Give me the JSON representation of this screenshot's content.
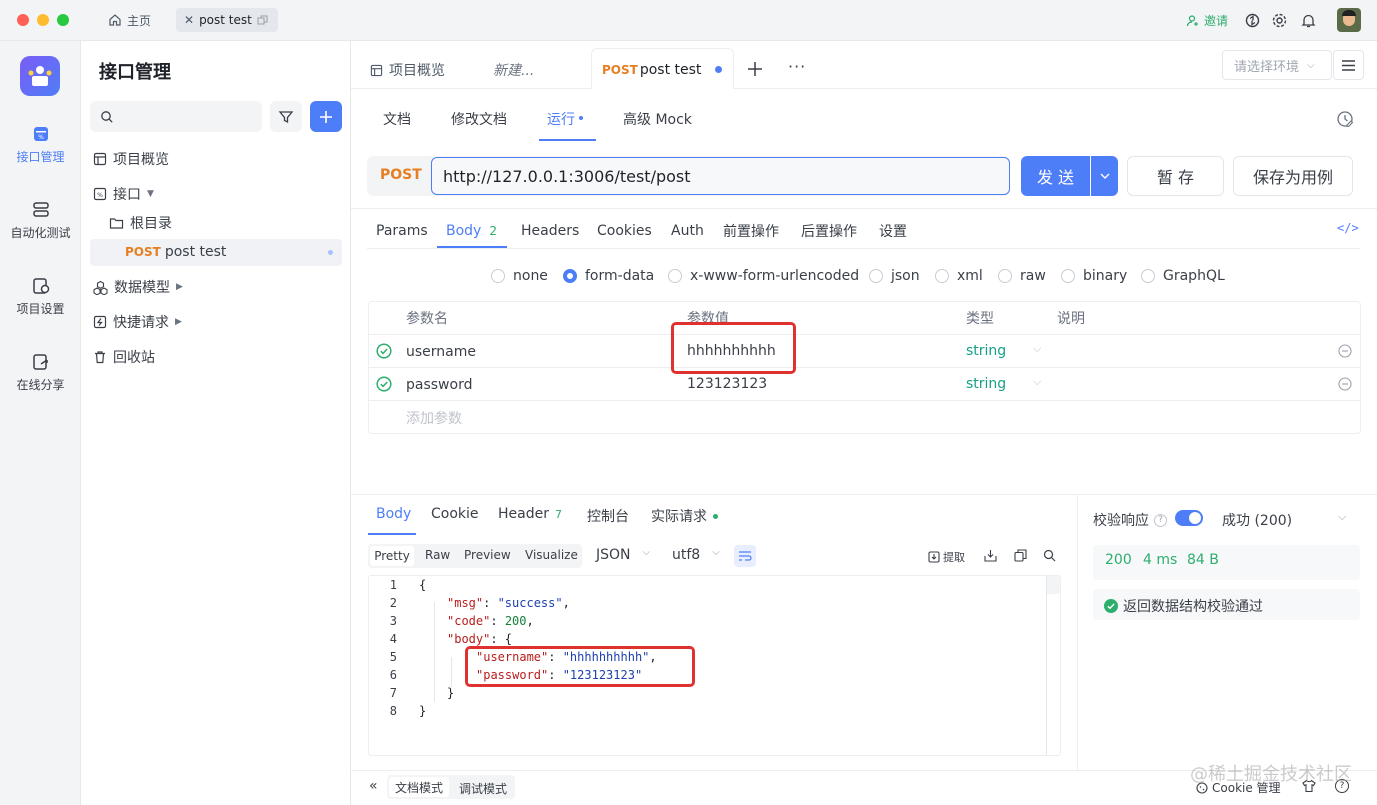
{
  "titlebar": {
    "home_tab": "主页",
    "active_tab": "post test",
    "invite": "邀请"
  },
  "rail": {
    "items": [
      {
        "label": "接口管理",
        "icon": "api-icon"
      },
      {
        "label": "自动化测试",
        "icon": "automation-icon"
      },
      {
        "label": "项目设置",
        "icon": "project-settings-icon"
      },
      {
        "label": "在线分享",
        "icon": "share-icon"
      }
    ]
  },
  "sidebar": {
    "title": "接口管理",
    "search_placeholder": "",
    "tree": {
      "overview": "项目概览",
      "api": "接口",
      "root": "根目录",
      "item_method": "POST",
      "item_name": "post test",
      "models": "数据模型",
      "quick": "快捷请求",
      "trash": "回收站"
    }
  },
  "main": {
    "tabs": {
      "overview": "项目概览",
      "new": "新建...",
      "active_method": "POST",
      "active_name": "post test"
    },
    "env_placeholder": "请选择环境",
    "subtabs": [
      "文档",
      "修改文档",
      "运行",
      "高级 Mock"
    ],
    "request": {
      "method": "POST",
      "url": "http://127.0.0.1:3006/test/post",
      "send": "发 送",
      "save": "暂 存",
      "save_case": "保存为用例"
    },
    "param_tabs": {
      "params": "Params",
      "body": "Body",
      "body_count": "2",
      "headers": "Headers",
      "cookies": "Cookies",
      "auth": "Auth",
      "pre": "前置操作",
      "post": "后置操作",
      "settings": "设置"
    },
    "body_types": [
      "none",
      "form-data",
      "x-www-form-urlencoded",
      "json",
      "xml",
      "raw",
      "binary",
      "GraphQL"
    ],
    "body_type_selected": "form-data",
    "table": {
      "headers": [
        "参数名",
        "参数值",
        "类型",
        "说明"
      ],
      "rows": [
        {
          "name": "username",
          "value": "hhhhhhhhhh",
          "type": "string"
        },
        {
          "name": "password",
          "value": "123123123",
          "type": "string"
        }
      ],
      "add_placeholder": "添加参数"
    }
  },
  "response": {
    "tabs": {
      "body": "Body",
      "cookie": "Cookie",
      "header": "Header",
      "header_count": "7",
      "console": "控制台",
      "actual": "实际请求"
    },
    "view_tabs": [
      "Pretty",
      "Raw",
      "Preview",
      "Visualize"
    ],
    "format": "JSON",
    "encoding": "utf8",
    "extract": "提取",
    "code_lines": [
      {
        "n": "1",
        "html": "{"
      },
      {
        "n": "2",
        "key": "\"msg\"",
        "val": "\"success\"",
        "end": ","
      },
      {
        "n": "3",
        "key": "\"code\"",
        "num": "200",
        "end": ","
      },
      {
        "n": "4",
        "key": "\"body\"",
        "end": ": {"
      },
      {
        "n": "5",
        "key": "\"username\"",
        "val": "\"hhhhhhhhhh\"",
        "end": ","
      },
      {
        "n": "6",
        "key": "\"password\"",
        "val": "\"123123123\"",
        "end": ""
      },
      {
        "n": "7",
        "html": "}"
      },
      {
        "n": "8",
        "html": "}"
      }
    ],
    "validate_label": "校验响应",
    "status_text": "成功 (200)",
    "status_code": "200",
    "time": "4 ms",
    "size": "84 B",
    "validate_pass": "返回数据结构校验通过"
  },
  "footer": {
    "doc_mode": "文档模式",
    "debug_mode": "调试模式",
    "cookie_manage": "Cookie 管理",
    "watermark": "@稀土掘金技术社区"
  },
  "colors": {
    "accent": "#4e7ef7",
    "method_post": "#e67e22",
    "highlight_box": "#e03131",
    "success": "#2eae6c"
  }
}
